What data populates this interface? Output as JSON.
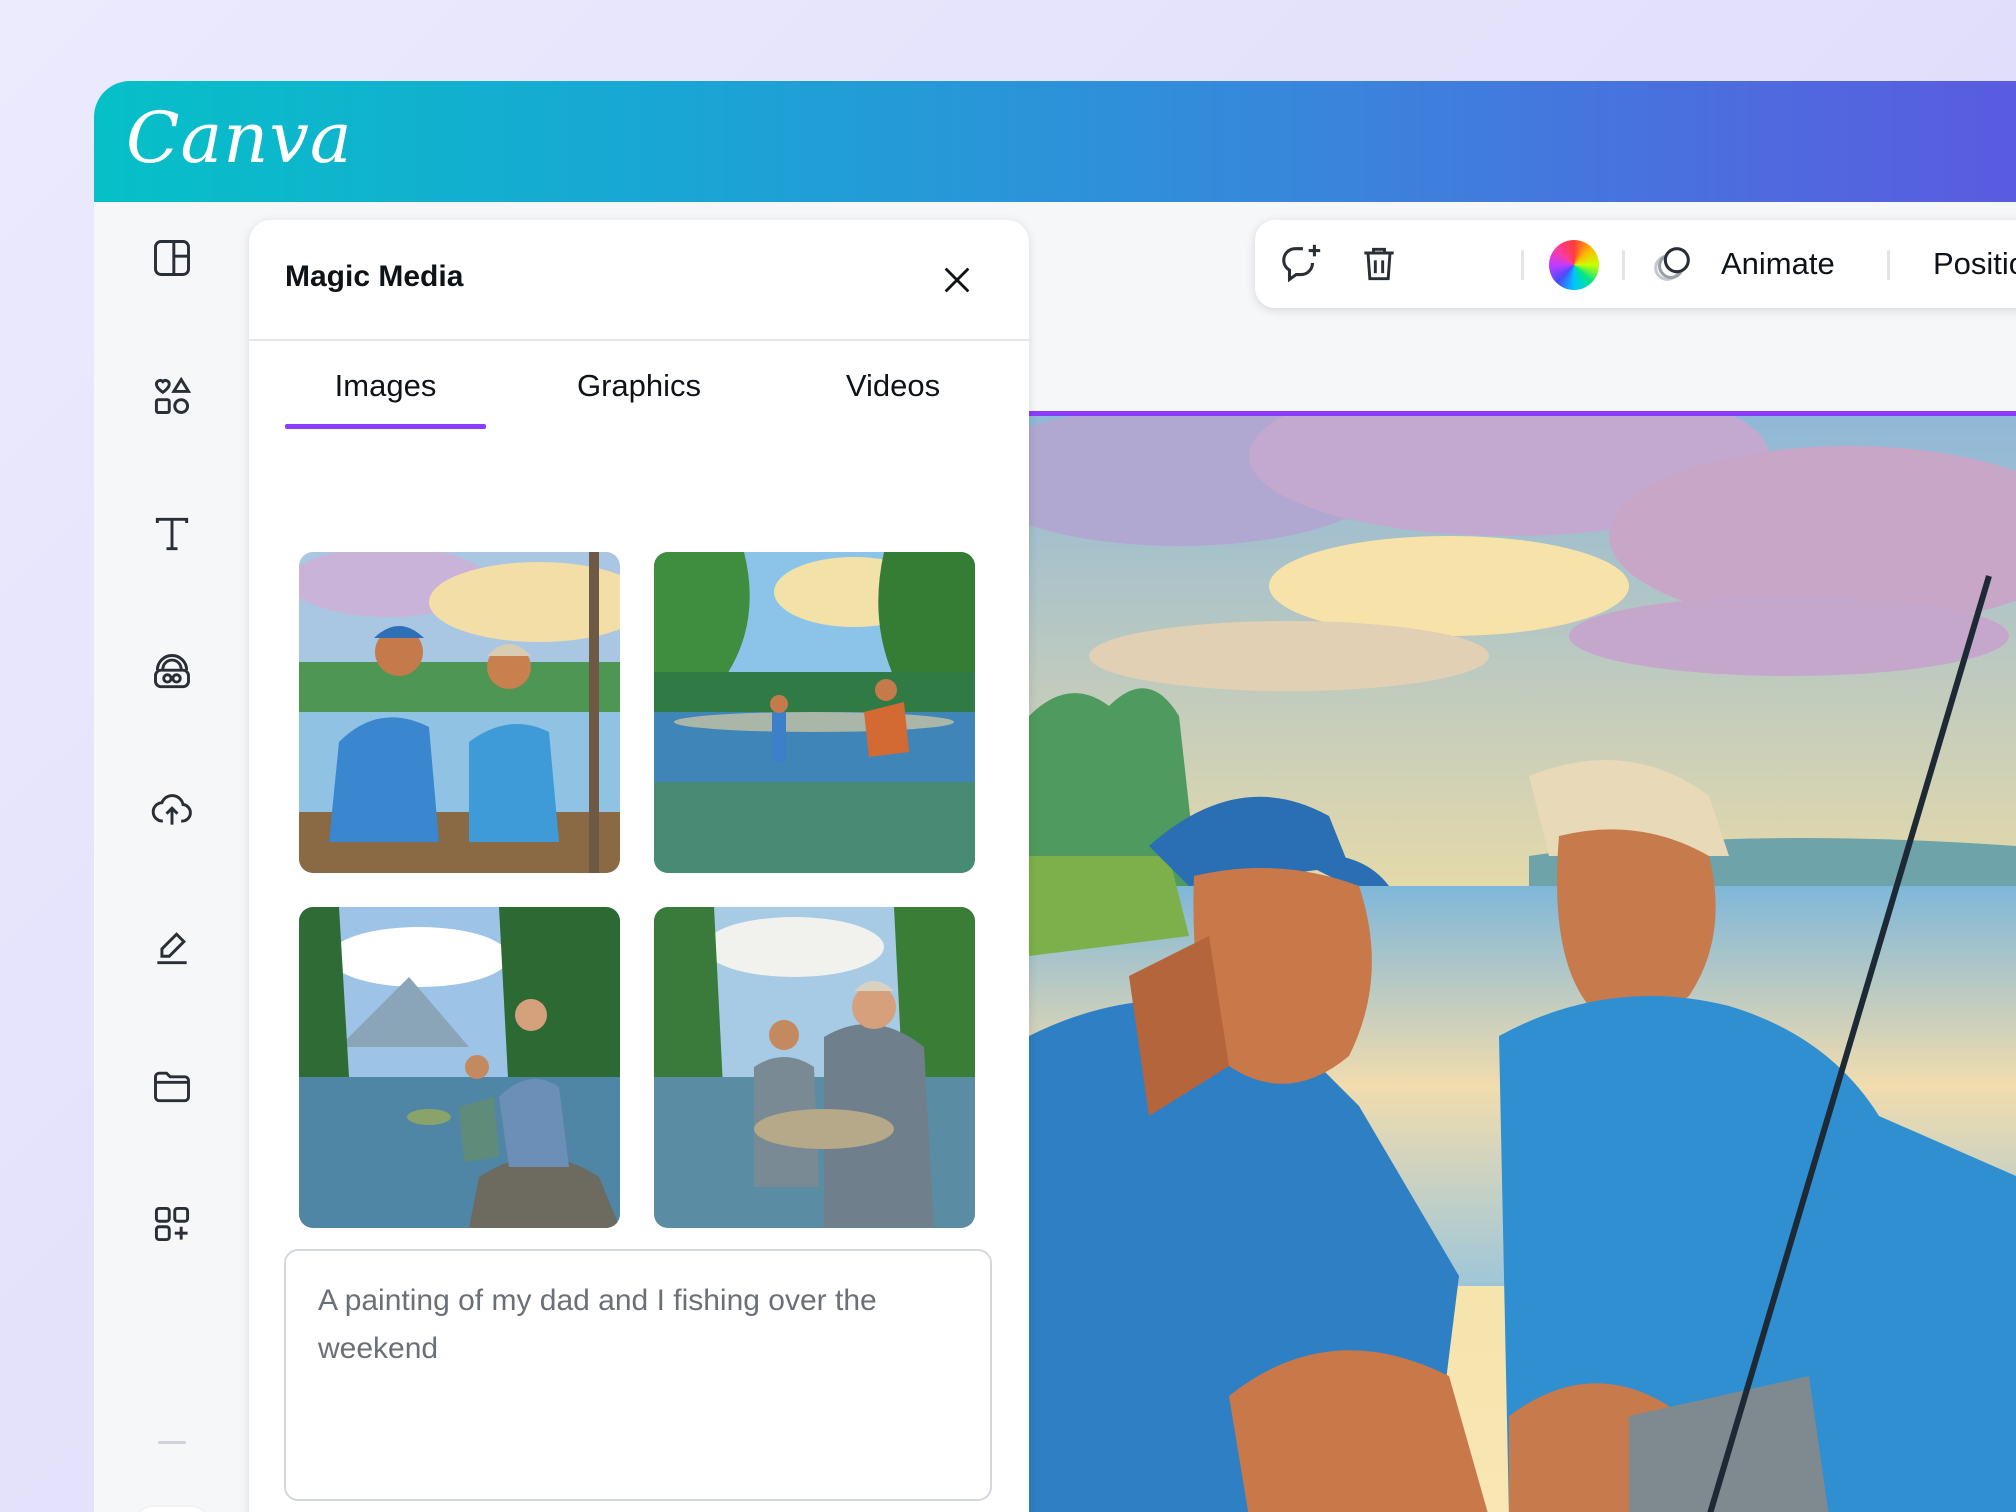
{
  "app": {
    "logo_text": "Canva",
    "brand_colors": {
      "gradient_start": "#06c0c7",
      "gradient_end": "#5a5be0",
      "accent": "#8b3dff"
    }
  },
  "rail": {
    "items": [
      {
        "icon": "layout-icon",
        "name": "rail-item-design"
      },
      {
        "icon": "elements-icon",
        "name": "rail-item-elements"
      },
      {
        "icon": "text-icon",
        "name": "rail-item-text"
      },
      {
        "icon": "brand-icon",
        "name": "rail-item-brand"
      },
      {
        "icon": "upload-icon",
        "name": "rail-item-uploads"
      },
      {
        "icon": "draw-icon",
        "name": "rail-item-draw"
      },
      {
        "icon": "folder-icon",
        "name": "rail-item-projects"
      },
      {
        "icon": "apps-icon",
        "name": "rail-item-apps"
      }
    ],
    "magic_media_icon": "magic-media-icon"
  },
  "panel": {
    "title": "Magic Media",
    "tabs": [
      {
        "label": "Images",
        "active": true
      },
      {
        "label": "Graphics",
        "active": false
      },
      {
        "label": "Videos",
        "active": false
      }
    ],
    "results": [
      {
        "name": "generated-image-1"
      },
      {
        "name": "generated-image-2"
      },
      {
        "name": "generated-image-3"
      },
      {
        "name": "generated-image-4"
      }
    ],
    "prompt": {
      "value": "A painting of my dad and I fishing over the weekend"
    }
  },
  "toolbar": {
    "comment_icon": "add-comment-icon",
    "delete_icon": "trash-icon",
    "color_icon": "color-wheel-icon",
    "animate_label": "Animate",
    "position_label": "Position"
  }
}
